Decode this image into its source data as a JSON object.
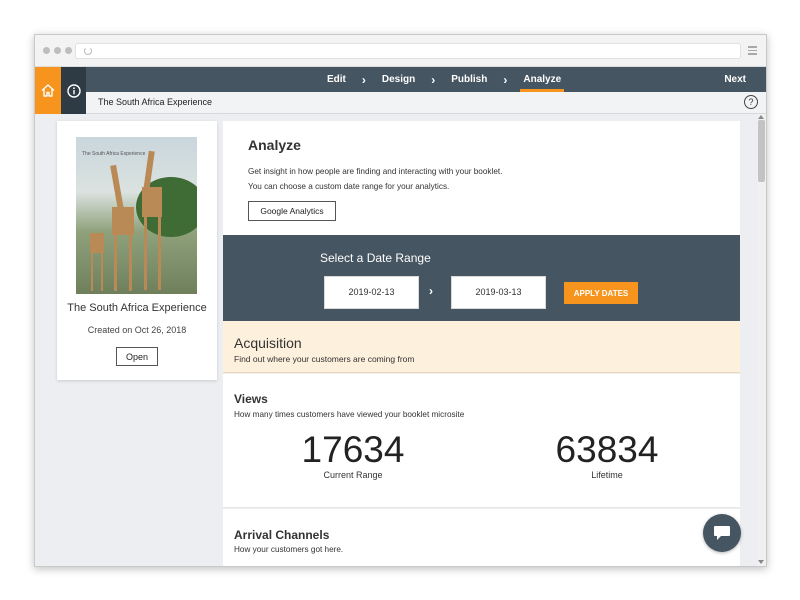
{
  "nav": {
    "steps": [
      {
        "label": "Edit"
      },
      {
        "label": "Design"
      },
      {
        "label": "Publish"
      },
      {
        "label": "Analyze",
        "active": true
      }
    ],
    "next_label": "Next"
  },
  "subbar": {
    "title": "The South Africa Experience",
    "help_label": "?"
  },
  "book": {
    "cover_title": "The South Africa Experience",
    "name": "The South Africa Experience",
    "created": "Created on Oct 26, 2018",
    "open_label": "Open"
  },
  "analyze": {
    "heading": "Analyze",
    "description": "Get insight in how people are finding and interacting with your booklet. You can choose a custom date range for your analytics.",
    "ga_label": "Google Analytics"
  },
  "date_range": {
    "heading": "Select a Date Range",
    "start": "2019-02-13",
    "end": "2019-03-13",
    "apply_label": "APPLY DATES"
  },
  "acquisition": {
    "heading": "Acquisition",
    "subtitle": "Find out where your customers are coming from"
  },
  "views": {
    "heading": "Views",
    "subtitle": "How many times customers have viewed your booklet microsite",
    "current_value": "17634",
    "current_label": "Current Range",
    "lifetime_value": "63834",
    "lifetime_label": "Lifetime"
  },
  "arrival": {
    "heading": "Arrival Channels",
    "subtitle": "How your customers got here."
  },
  "colors": {
    "accent": "#f7941d",
    "nav_dark": "#455561",
    "acquisition_bg": "#fdf0dd"
  }
}
